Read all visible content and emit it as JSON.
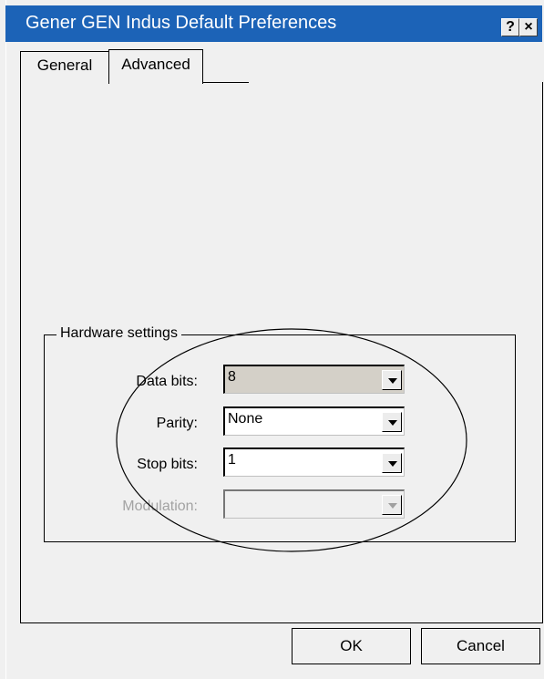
{
  "window": {
    "title": "Gener GEN Indus Default Preferences",
    "help_glyph": "?",
    "close_glyph": "×",
    "titlebar_color": "#1c63b7"
  },
  "tabs": [
    {
      "label": "General",
      "selected": false
    },
    {
      "label": "Advanced",
      "selected": true
    }
  ],
  "hardware_settings": {
    "title": "Hardware settings",
    "fields": [
      {
        "label": "Data bits:",
        "value": "8",
        "state": "readonly"
      },
      {
        "label": "Parity:",
        "value": "None",
        "state": "enabled"
      },
      {
        "label": "Stop bits:",
        "value": "1",
        "state": "enabled"
      },
      {
        "label": "Modulation:",
        "value": "",
        "state": "disabled"
      }
    ]
  },
  "buttons": {
    "ok": "OK",
    "cancel": "Cancel"
  },
  "icons": [
    "help-icon",
    "close-icon",
    "dropdown-arrow-icon"
  ]
}
